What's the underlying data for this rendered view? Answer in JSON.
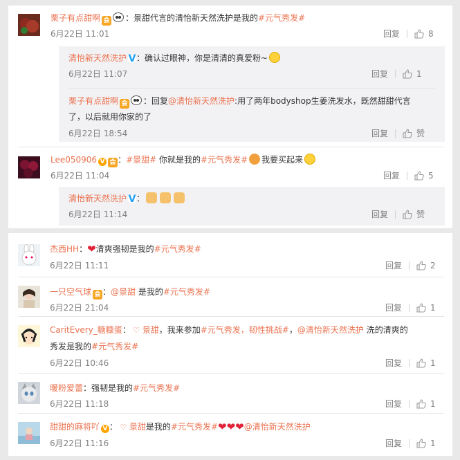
{
  "actions": {
    "reply_label": "回复",
    "like_label": "赞"
  },
  "comments_top": [
    {
      "user": "栗子有点甜啊",
      "text": "：景甜代言的清怡新天然洗护是我的",
      "tag": "#元气秀发#",
      "time": "6月22日 11:01",
      "likes": "8",
      "replies": [
        {
          "user": "清怡新天然洗护",
          "text": "：确认过眼神，你是清清的真爱粉~",
          "time": "6月22日 11:07",
          "likes": "1"
        },
        {
          "user": "栗子有点甜啊",
          "text_a": "：回复",
          "mention": "@清怡新天然洗护",
          "text_b": ":用了两年bodyshop生姜洗发水，既然甜甜代言",
          "text_c": "了，以后就用你家的了",
          "time": "6月22日 18:54",
          "likes": "赞"
        }
      ]
    },
    {
      "user": "Lee050906",
      "text_a": "：",
      "tag_a": "#景甜#",
      "text_b": " 你就是我的",
      "tag_b": "#元气秀发#",
      "text_c": "我要买起来",
      "time": "6月22日 11:04",
      "likes": "5",
      "replies": [
        {
          "user": "清怡新天然洗护",
          "text": "：",
          "time": "6月22日 11:14",
          "likes": "赞"
        }
      ]
    }
  ],
  "comments_bottom": [
    {
      "user": "杰西HH",
      "text_a": "：",
      "text_b": "清爽强韧是我的",
      "tag": "#元气秀发#",
      "time": "6月22日 11:11",
      "likes": "2"
    },
    {
      "user": "一只空气球",
      "text_a": "：",
      "mention": "@景甜",
      "text_b": " 是我的",
      "tag": "#元气秀发#",
      "time": "6月22日 21:04",
      "likes": "1"
    },
    {
      "user": "CaritEvery_糖糠蛋",
      "text_a": "：",
      "link1": "景甜",
      "text_b": "，我来参加",
      "tag_a": "#元气秀发，韧性挑战#",
      "text_c": "，",
      "mention": "@清怡新天然洗护",
      "text_d": " 洗的清爽的",
      "text_e": "秀发是我的",
      "tag_b": "#元气秀发#",
      "time": "6月22日 10:46",
      "likes": "1"
    },
    {
      "user": "暖粉爱蕾",
      "text_a": "：强韧是我的",
      "tag": "#元气秀发#",
      "time": "6月22日 11:18",
      "likes": "1"
    },
    {
      "user": "甜甜的麻将吖",
      "text_a": "：",
      "link1": "景甜",
      "text_b": "是我的",
      "tag": "#元气秀发#",
      "mention": "@清怡新天然洗护",
      "time": "6月22日 11:16",
      "likes": "1"
    }
  ]
}
